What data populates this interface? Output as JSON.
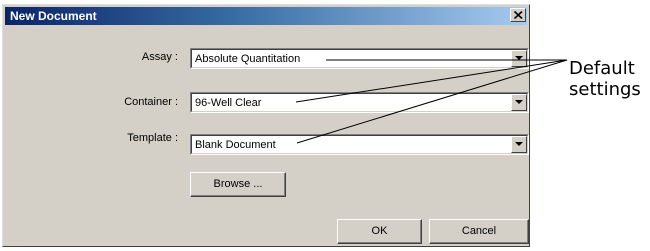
{
  "window": {
    "title": "New Document",
    "close_icon": "close-icon"
  },
  "form": {
    "assay": {
      "label": "Assay :",
      "value": "Absolute Quantitation"
    },
    "container": {
      "label": "Container :",
      "value": "96-Well Clear"
    },
    "template": {
      "label": "Template :",
      "value": "Blank Document"
    }
  },
  "buttons": {
    "browse": "Browse ...",
    "ok": "OK",
    "cancel": "Cancel"
  },
  "annotation": {
    "line1": "Default",
    "line2": "settings"
  },
  "colors": {
    "titlebar_start": "#0a246a",
    "titlebar_end": "#a6caf0",
    "dialog_face": "#d4d0c8"
  }
}
